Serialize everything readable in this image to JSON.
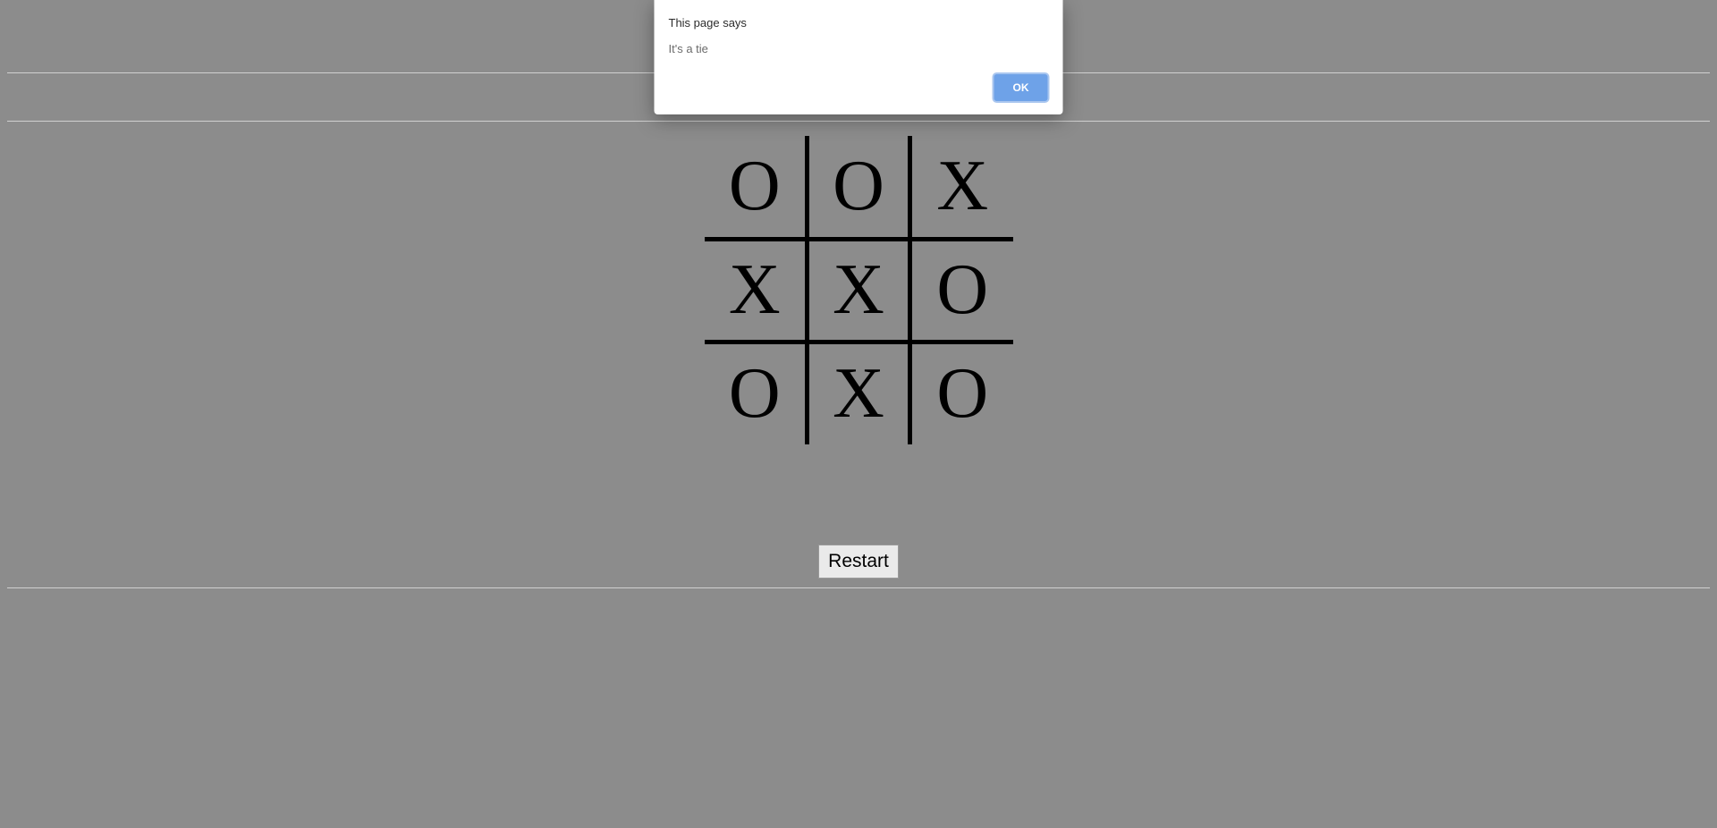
{
  "dialog": {
    "title": "This page says",
    "message": "It's a tie",
    "ok_label": "OK"
  },
  "board": {
    "cells": [
      [
        "O",
        "O",
        "X"
      ],
      [
        "X",
        "X",
        "O"
      ],
      [
        "O",
        "X",
        "O"
      ]
    ]
  },
  "controls": {
    "restart_label": "Restart"
  }
}
